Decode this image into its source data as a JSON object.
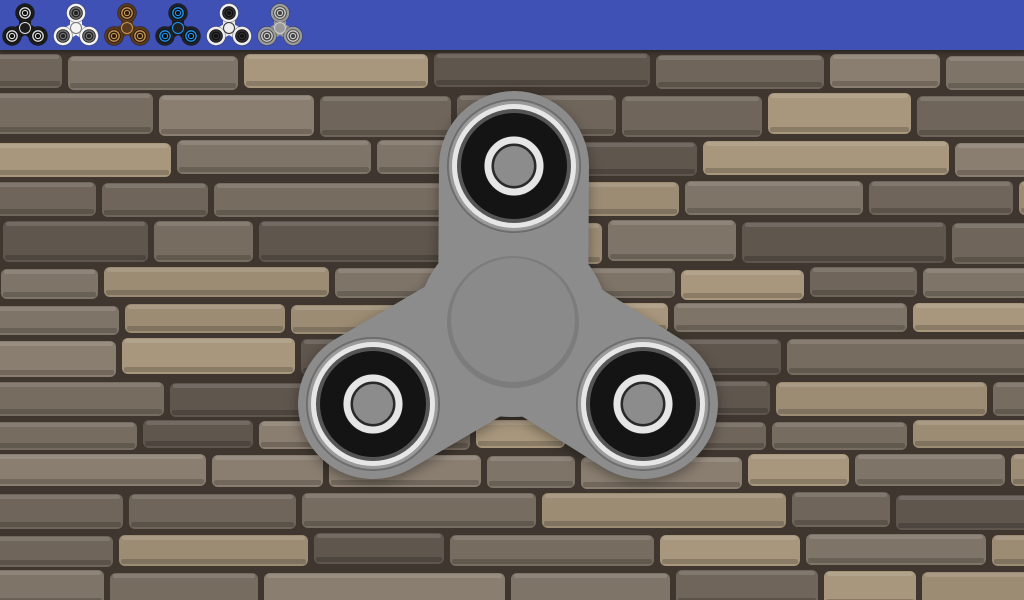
{
  "toolbar": {
    "background": "#3f51b5",
    "spinners": [
      {
        "icon": "black-spinner-icon",
        "body": "#1c1c1c",
        "ring": "#e0e0e0",
        "bearing": "#111111"
      },
      {
        "icon": "white-spinner-icon",
        "body": "#f4f4f4",
        "ring": "#777777",
        "bearing": "#222222"
      },
      {
        "icon": "bronze-spinner-icon",
        "body": "#5a3a1e",
        "ring": "#c89858",
        "bearing": "#2a1a0c"
      },
      {
        "icon": "blue-black-spinner-icon",
        "body": "#1e2226",
        "ring": "#2196f3",
        "bearing": "#0d0d0d"
      },
      {
        "icon": "white-metal-spinner-icon",
        "body": "#eeeeee",
        "ring": "#333333",
        "bearing": "#111111"
      },
      {
        "icon": "gray-spinner-icon",
        "body": "#9a9a9a",
        "ring": "#cfcfcf",
        "bearing": "#444444"
      }
    ]
  },
  "spinner": {
    "icon": "fidget-spinner-icon",
    "body_color": "#8c8c8c",
    "hub_color": "#8a8a8a",
    "bearing_color": "#141414",
    "ring_color": "#e6e6e6"
  },
  "background": {
    "icon": "stone-wall-texture",
    "stone_colors": [
      "#7f7468",
      "#6f655b",
      "#a8977d",
      "#8a7e70",
      "#5f564e",
      "#9c8c74",
      "#776c60"
    ]
  }
}
